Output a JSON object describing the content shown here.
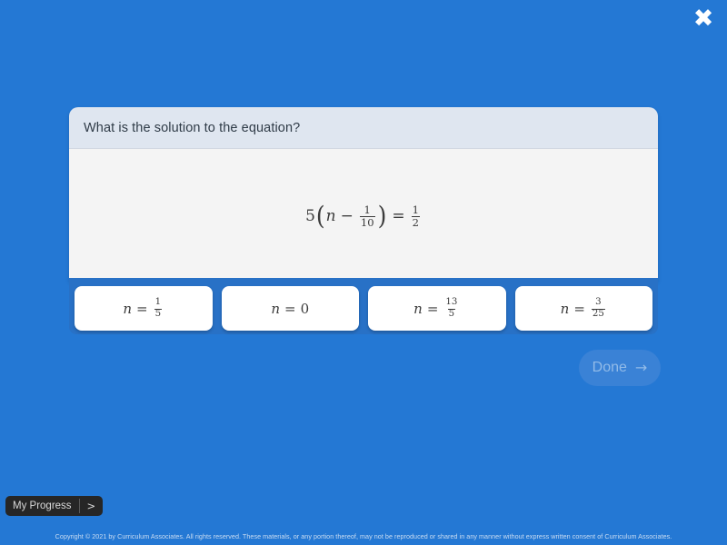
{
  "colors": {
    "background_blue": "#2478d4",
    "tray_blue": "#2871c6",
    "card_header": "#dfe6f0",
    "card_body": "#f4f4f4",
    "done_fill": "#3a82d6",
    "done_text": "#92bbe8",
    "pill_dark": "#262626"
  },
  "close": {
    "icon": "close-icon",
    "glyph": "✖"
  },
  "question": {
    "prompt": "What is the solution to the equation?",
    "equation": {
      "coefficient": "5",
      "open_paren": "(",
      "variable": "n",
      "operator": "−",
      "inner_fraction": {
        "numerator": "1",
        "denominator": "10"
      },
      "close_paren": ")",
      "equals": "=",
      "right_fraction": {
        "numerator": "1",
        "denominator": "2"
      },
      "plain_text": "5 ( n − 1/10 ) = 1/2"
    }
  },
  "answers": [
    {
      "variable": "n",
      "equals": "=",
      "value_type": "fraction",
      "numerator": "1",
      "denominator": "5",
      "plain_text": "n = 1/5"
    },
    {
      "variable": "n",
      "equals": "=",
      "value_type": "integer",
      "value": "0",
      "plain_text": "n = 0"
    },
    {
      "variable": "n",
      "equals": "=",
      "value_type": "fraction",
      "numerator": "13",
      "denominator": "5",
      "plain_text": "n = 13/5"
    },
    {
      "variable": "n",
      "equals": "=",
      "value_type": "fraction",
      "numerator": "3",
      "denominator": "25",
      "plain_text": "n = 3/25"
    }
  ],
  "done_button": {
    "label": "Done",
    "arrow": "→",
    "state": "disabled"
  },
  "progress": {
    "label": "My Progress",
    "chevron": ">"
  },
  "footer": {
    "copyright": "Copyright © 2021 by Curriculum Associates. All rights reserved. These materials, or any portion thereof, may not be reproduced or shared in any manner without express written consent of Curriculum Associates."
  }
}
